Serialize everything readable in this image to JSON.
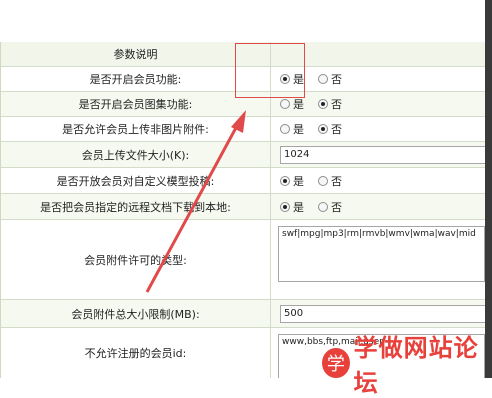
{
  "header": {
    "title": "参数说明"
  },
  "rows": {
    "member_enable": {
      "label": "是否开启会员功能:",
      "opt_yes": "是",
      "opt_no": "否",
      "selected": "yes"
    },
    "member_album": {
      "label": "是否开启会员图集功能:",
      "opt_yes": "是",
      "opt_no": "否",
      "selected": "no"
    },
    "upload_nonimage": {
      "label": "是否允许会员上传非图片附件:",
      "opt_yes": "是",
      "opt_no": "否",
      "selected": "no"
    },
    "upload_size": {
      "label": "会员上传文件大小(K):",
      "value": "1024"
    },
    "custom_model": {
      "label": "是否开放会员对自定义模型投稿:",
      "opt_yes": "是",
      "opt_no": "否",
      "selected": "yes"
    },
    "remote_download": {
      "label": "是否把会员指定的远程文档下载到本地:",
      "opt_yes": "是",
      "opt_no": "否",
      "selected": "yes"
    },
    "allowed_types": {
      "label": "会员附件许可的类型:",
      "value": "swf|mpg|mp3|rm|rmvb|wmv|wma|wav|mid"
    },
    "total_size": {
      "label": "会员附件总大小限制(MB):",
      "value": "500"
    },
    "banned_ids": {
      "label": "不允许注册的会员id:",
      "value": "www,bbs,ftp,mail,user"
    }
  },
  "watermark": {
    "logo": "学",
    "text": "学做网站论坛"
  },
  "colors": {
    "annotation": "#e04a4a",
    "watermark": "#e8413b"
  }
}
